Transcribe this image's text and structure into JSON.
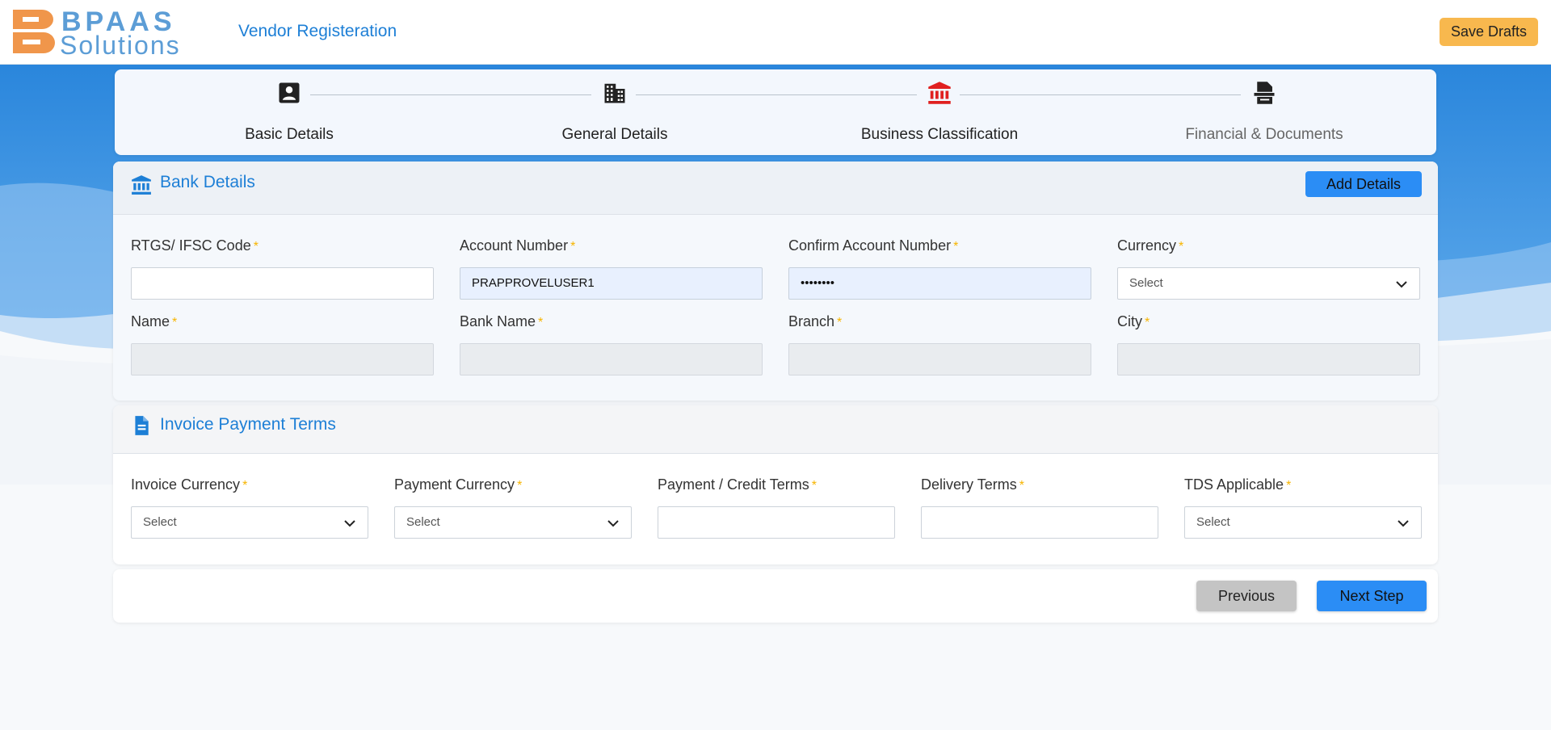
{
  "header": {
    "logo_line1": "BPAAS",
    "logo_line2": "Solutions",
    "title": "Vendor Registeration",
    "save_drafts_label": "Save Drafts"
  },
  "stepper": {
    "steps": [
      {
        "label": "Basic Details",
        "icon": "person-card-icon",
        "state": "done"
      },
      {
        "label": "General Details",
        "icon": "building-icon",
        "state": "done"
      },
      {
        "label": "Business Classification",
        "icon": "bank-icon",
        "state": "active"
      },
      {
        "label": "Financial & Documents",
        "icon": "file-signature-icon",
        "state": "pending"
      }
    ]
  },
  "bank_details": {
    "title": "Bank Details",
    "add_button": "Add Details",
    "fields": {
      "ifsc": {
        "label": "RTGS/ IFSC Code",
        "value": ""
      },
      "account_number": {
        "label": "Account Number",
        "value": "PRAPPROVELUSER1"
      },
      "confirm_account": {
        "label": "Confirm Account Number",
        "value": "••••••••"
      },
      "currency": {
        "label": "Currency",
        "value": "Select"
      },
      "name": {
        "label": "Name",
        "value": ""
      },
      "bank_name": {
        "label": "Bank Name",
        "value": ""
      },
      "branch": {
        "label": "Branch",
        "value": ""
      },
      "city": {
        "label": "City",
        "value": ""
      }
    }
  },
  "invoice_terms": {
    "title": "Invoice Payment Terms",
    "fields": {
      "invoice_currency": {
        "label": "Invoice Currency",
        "value": "Select"
      },
      "payment_currency": {
        "label": "Payment Currency",
        "value": "Select"
      },
      "credit_terms": {
        "label": "Payment / Credit Terms",
        "value": ""
      },
      "delivery_terms": {
        "label": "Delivery Terms",
        "value": ""
      },
      "tds_applicable": {
        "label": "TDS Applicable",
        "value": "Select"
      }
    }
  },
  "nav": {
    "previous_label": "Previous",
    "next_label": "Next Step"
  },
  "required_mark": "*",
  "colors": {
    "accent": "#2b8df5",
    "title_blue": "#1d7fd6",
    "required": "#f7b500",
    "save_drafts": "#f8b84e",
    "active_step": "#e02020"
  }
}
